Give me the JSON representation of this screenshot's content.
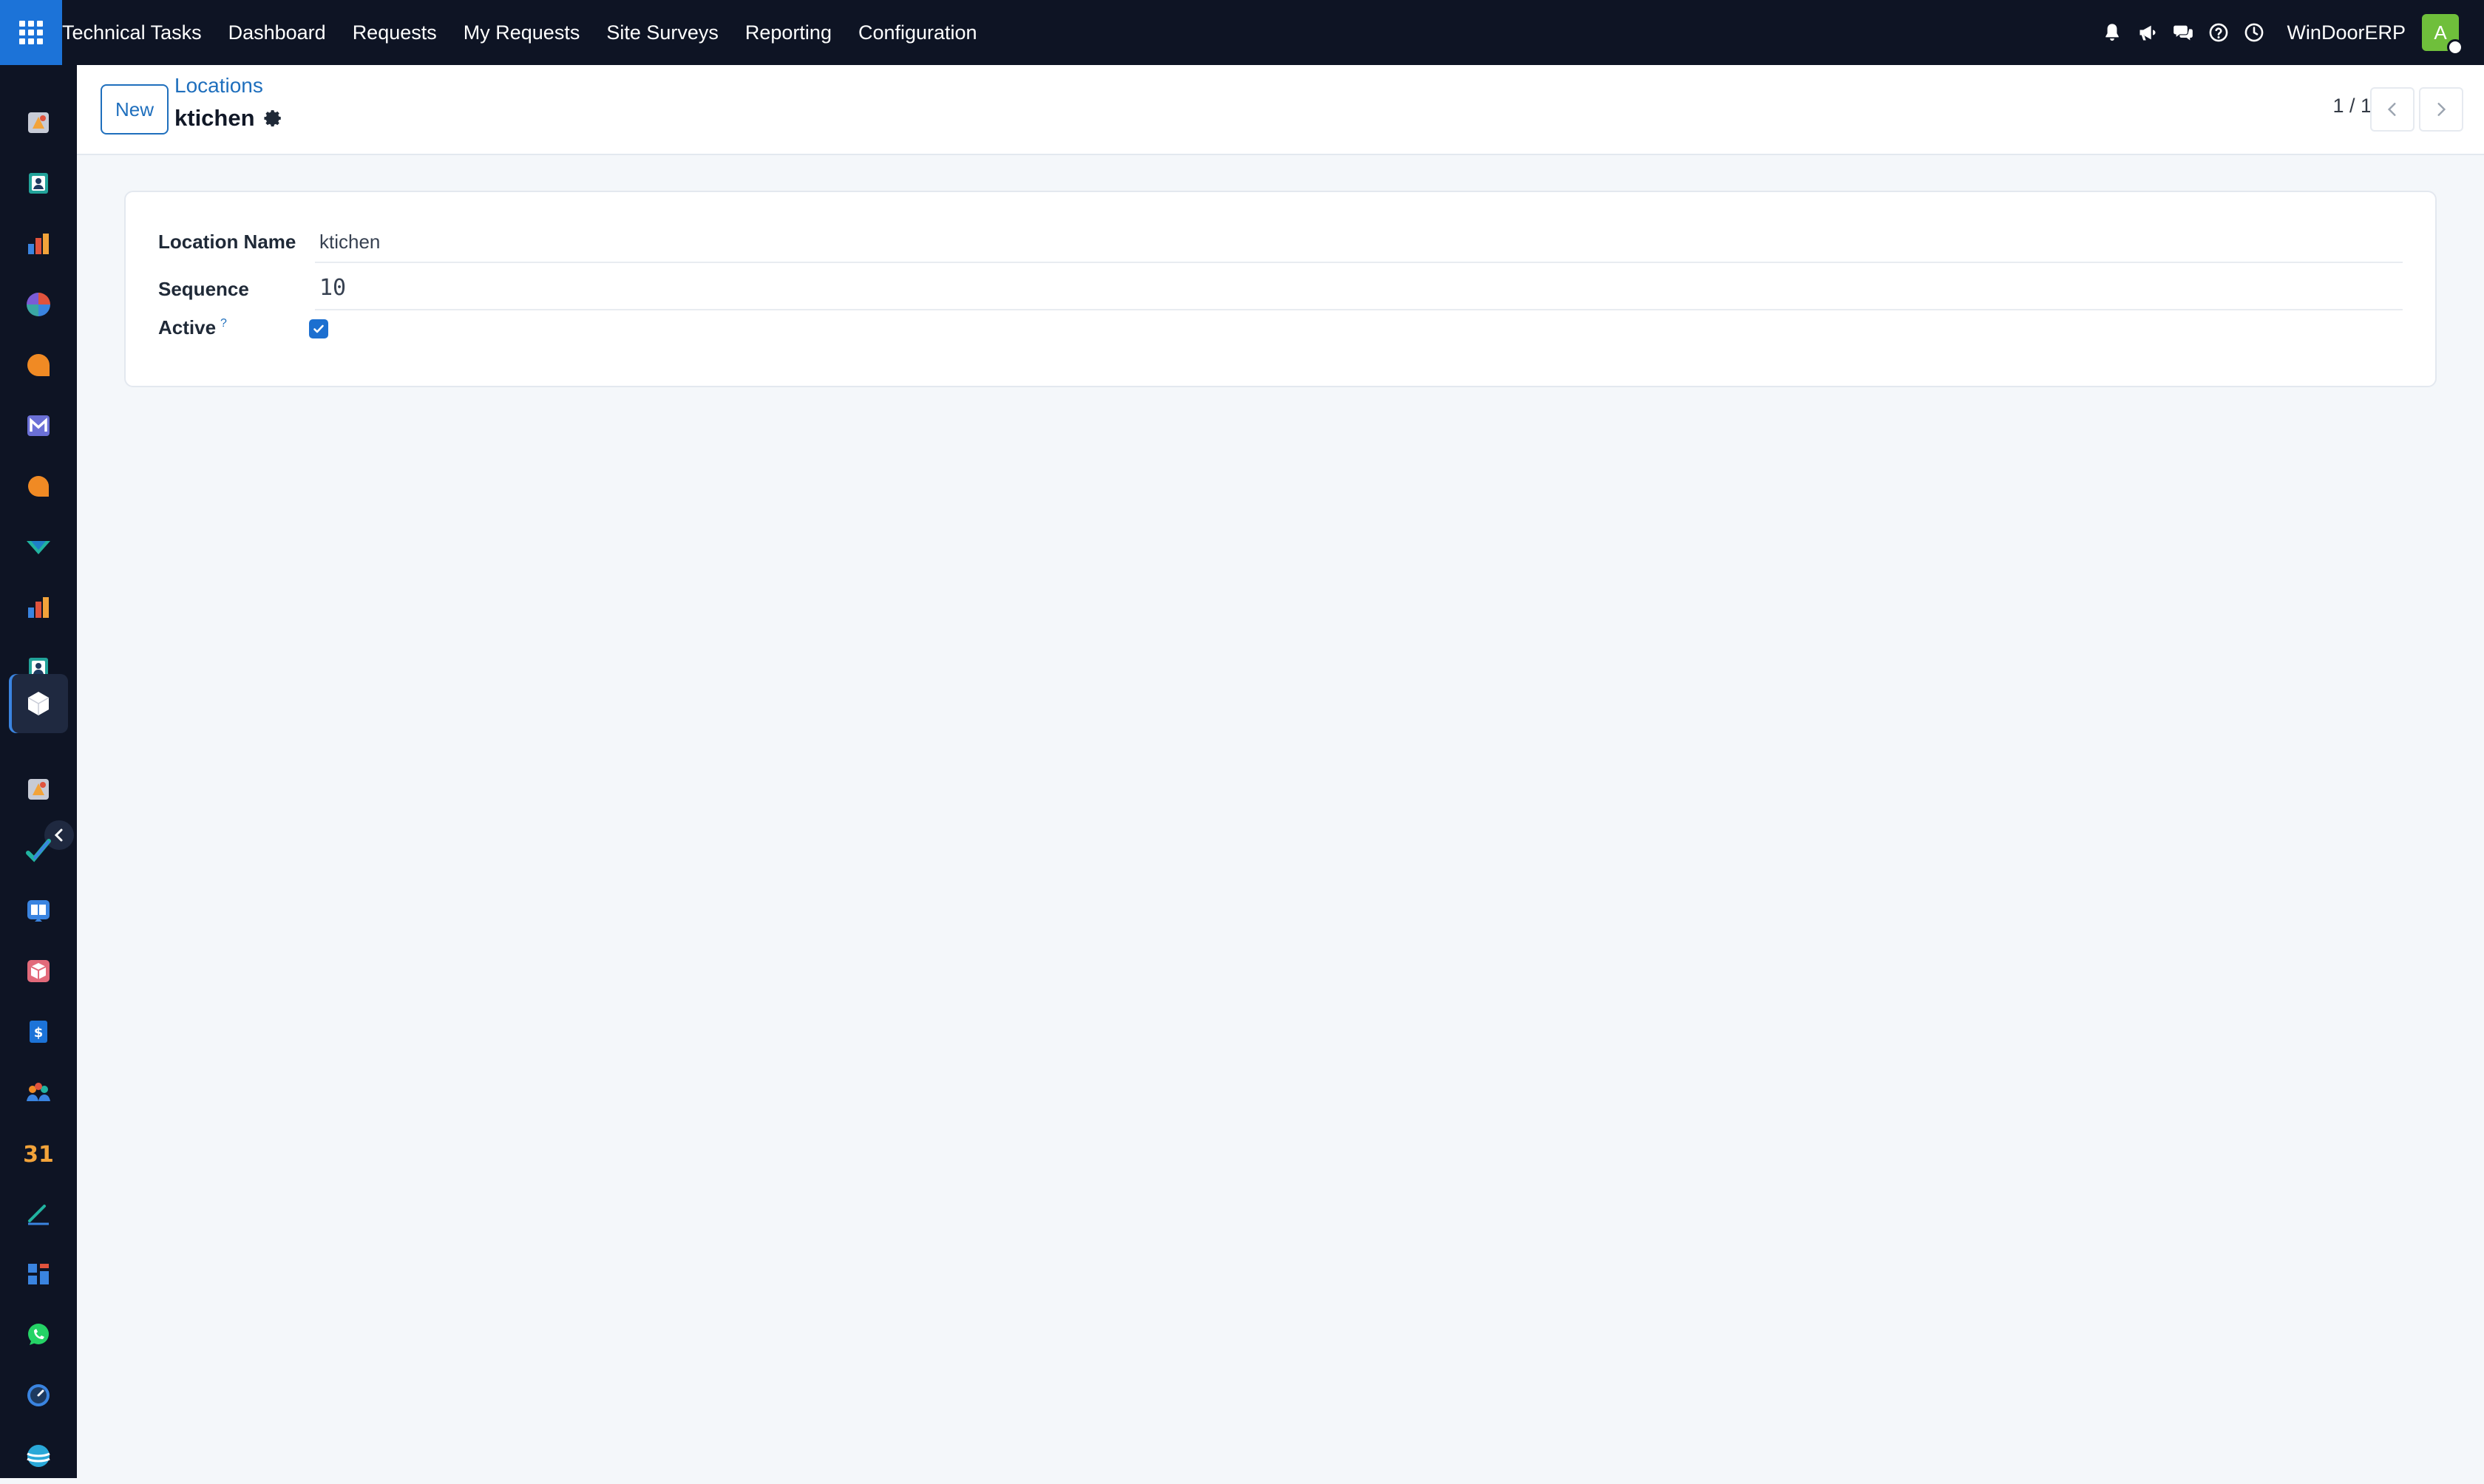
{
  "topbar": {
    "app_name": "Technical Tasks",
    "menu": [
      "Dashboard",
      "Requests",
      "My Requests",
      "Site Surveys",
      "Reporting",
      "Configuration"
    ],
    "company": "WinDoorERP",
    "avatar_letter": "A",
    "icons": [
      "bell-icon",
      "megaphone-icon",
      "chat-icon",
      "help-icon",
      "clock-icon"
    ]
  },
  "sidebar": {
    "items": [
      {
        "icon": "app-icon-1",
        "color": "#f2a33a"
      },
      {
        "icon": "contacts-icon",
        "color": "#22a39a"
      },
      {
        "icon": "reports-icon",
        "color": "#e0533d"
      },
      {
        "icon": "pie-icon",
        "color": "#3aa7a3"
      },
      {
        "icon": "discuss-icon",
        "color": "#f08a24"
      },
      {
        "icon": "mail-icon",
        "color": "#6b70d6"
      },
      {
        "icon": "livechat-icon",
        "color": "#f08a24"
      },
      {
        "icon": "check-icon",
        "color": "#21b3a0"
      },
      {
        "icon": "reports-icon-2",
        "color": "#e0533d"
      },
      {
        "icon": "contacts-icon-2",
        "color": "#22a39a"
      },
      {
        "icon": "technical-tasks-icon",
        "color": "#ffffff"
      },
      {
        "icon": "app-icon-2",
        "color": "#f2a33a"
      },
      {
        "icon": "tasks-icon",
        "color": "#21b3a0"
      },
      {
        "icon": "knowledge-icon",
        "color": "#3a84e0"
      },
      {
        "icon": "inventory-icon",
        "color": "#e26a7a"
      },
      {
        "icon": "invoice-icon",
        "color": "#1c73d8"
      },
      {
        "icon": "employees-icon",
        "color": "#f08a24"
      },
      {
        "icon": "calendar-icon",
        "color": "#f2a33a"
      },
      {
        "icon": "sign-icon",
        "color": "#21b3a0"
      },
      {
        "icon": "dashboard-icon",
        "color": "#3a84e0"
      },
      {
        "icon": "whatsapp-icon",
        "color": "#25d366"
      },
      {
        "icon": "timer-icon",
        "color": "#3a84e0"
      },
      {
        "icon": "website-icon",
        "color": "#2aa8d8"
      }
    ],
    "calendar_text": "31"
  },
  "control_panel": {
    "new_label": "New",
    "breadcrumb": "Locations",
    "record_title": "ktichen",
    "pager_text": "1 / 1"
  },
  "form": {
    "location_name_label": "Location Name",
    "location_name_value": "ktichen",
    "sequence_label": "Sequence",
    "sequence_value": "10",
    "active_label": "Active",
    "active_help": "?",
    "active_checked": true
  }
}
